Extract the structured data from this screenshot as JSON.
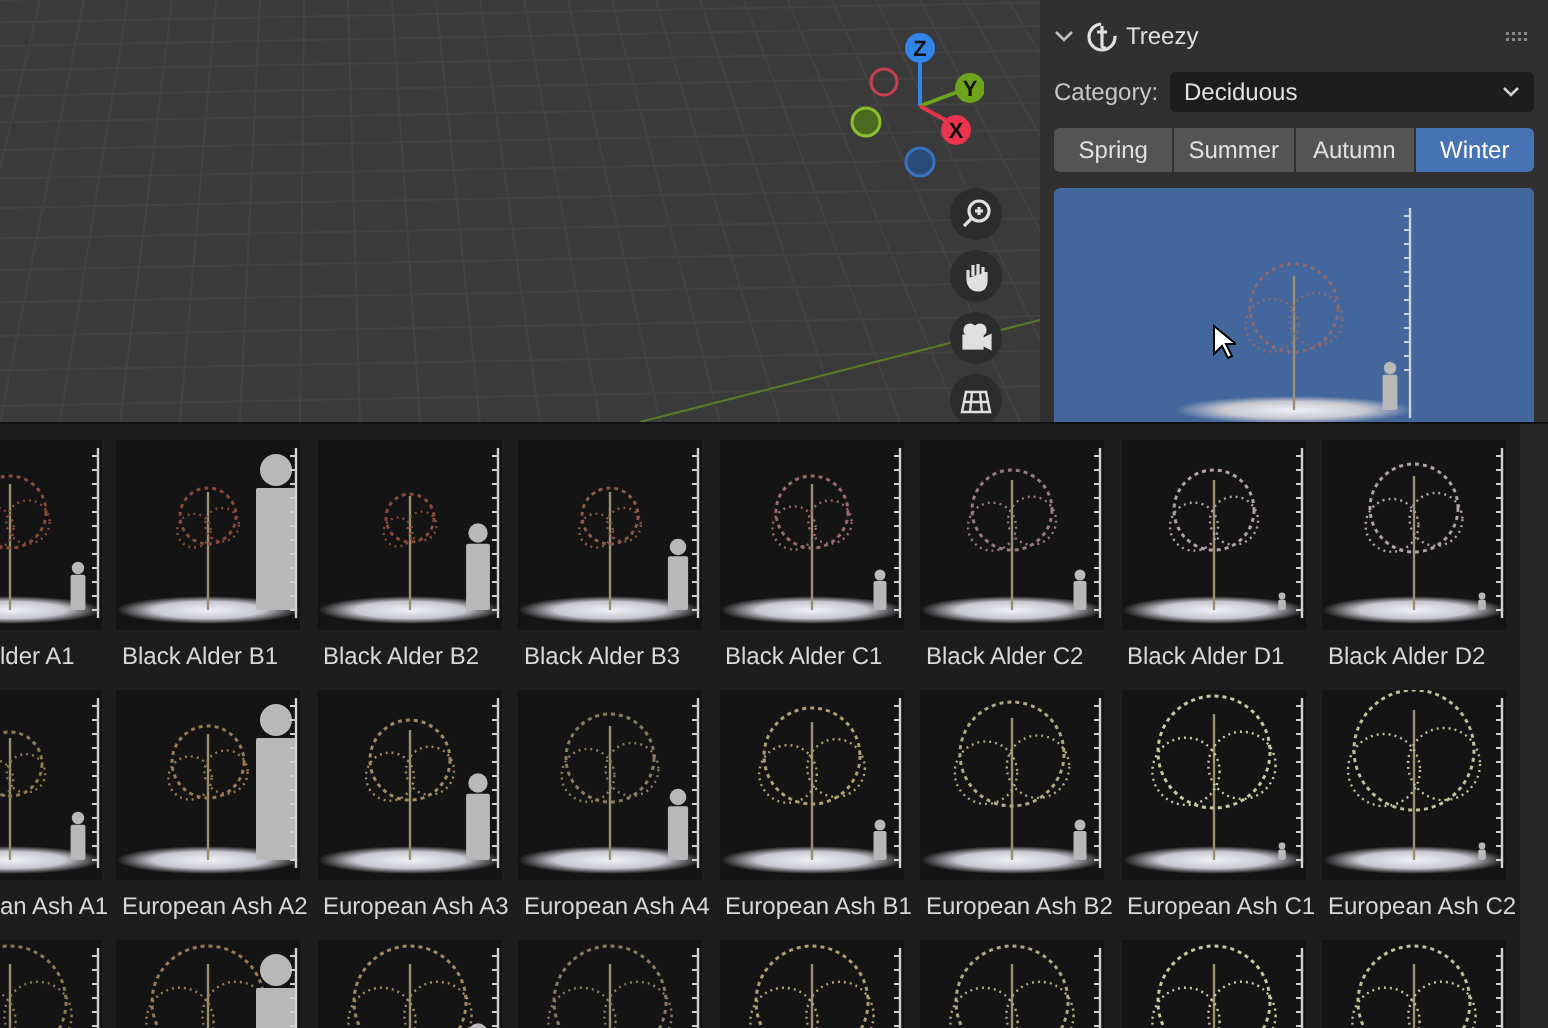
{
  "viewport": {
    "gizmo_axes": [
      {
        "label": "Z",
        "color": "#2f86e8"
      },
      {
        "label": "Y",
        "color": "#6ea31c"
      },
      {
        "label": "X",
        "color": "#e8344c"
      }
    ]
  },
  "panel": {
    "title": "Treezy",
    "expanded": true,
    "category": {
      "label": "Category:",
      "value": "Deciduous"
    },
    "seasons": [
      {
        "label": "Spring",
        "selected": false
      },
      {
        "label": "Summer",
        "selected": false
      },
      {
        "label": "Autumn",
        "selected": false
      },
      {
        "label": "Winter",
        "selected": true
      }
    ]
  },
  "library": {
    "rows": [
      {
        "items": [
          {
            "label": "lder A1"
          },
          {
            "label": "Black Alder B1"
          },
          {
            "label": "Black Alder B2"
          },
          {
            "label": "Black Alder B3"
          },
          {
            "label": "Black Alder C1"
          },
          {
            "label": "Black Alder C2"
          },
          {
            "label": "Black Alder D1"
          },
          {
            "label": "Black Alder D2"
          }
        ]
      },
      {
        "items": [
          {
            "label": "an Ash A1"
          },
          {
            "label": "European Ash A2"
          },
          {
            "label": "European Ash A3"
          },
          {
            "label": "European Ash A4"
          },
          {
            "label": "European Ash B1"
          },
          {
            "label": "European Ash B2"
          },
          {
            "label": "European Ash C1"
          },
          {
            "label": "European Ash C2"
          }
        ]
      },
      {
        "items": [
          {
            "kind": "thumbnail"
          },
          {
            "kind": "thumbnail"
          },
          {
            "kind": "thumbnail"
          },
          {
            "kind": "thumbnail"
          },
          {
            "kind": "thumbnail"
          },
          {
            "kind": "thumbnail"
          },
          {
            "kind": "thumbnail"
          },
          {
            "kind": "thumbnail"
          }
        ]
      }
    ]
  }
}
